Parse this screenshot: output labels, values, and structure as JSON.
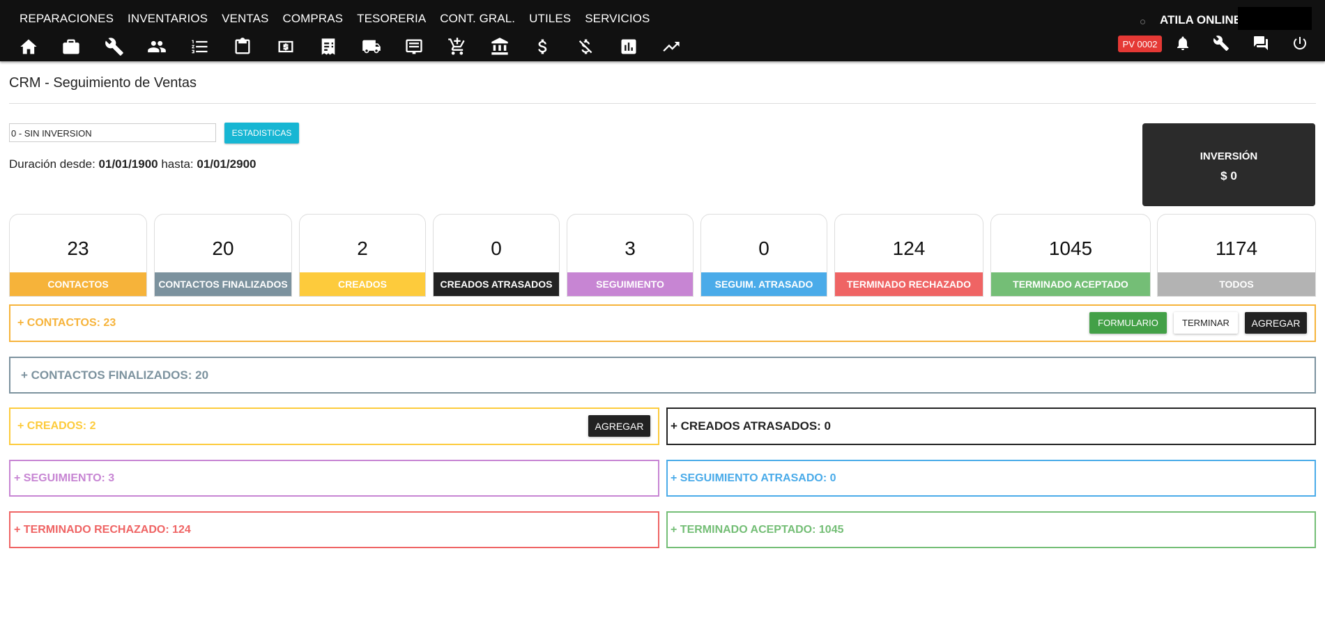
{
  "menu": [
    "REPARACIONES",
    "INVENTARIOS",
    "VENTAS",
    "COMPRAS",
    "TESORERIA",
    "CONT. GRAL.",
    "UTILES",
    "SERVICIOS"
  ],
  "toolbar_icons": [
    "home-icon",
    "briefcase-icon",
    "wrench-icon",
    "people-icon",
    "list-icon",
    "clipboard-icon",
    "money-icon",
    "invoice-icon",
    "truck-icon",
    "receipt-icon",
    "cart-icon",
    "bank-icon",
    "dollar-icon",
    "dollar-off-icon",
    "bar-chart-icon",
    "trending-icon"
  ],
  "user": "ATILA ONLINE",
  "pv_badge": "PV 0002",
  "page_title": "CRM - Seguimiento de Ventas",
  "select_value": "0 - SIN INVERSION",
  "stats_button": "ESTADISTICAS",
  "duration": {
    "prefix": "Duración desde: ",
    "from": "01/01/1900",
    "middle": " hasta: ",
    "to": "01/01/2900"
  },
  "investment": {
    "label": "INVERSIÓN",
    "value": "$ 0"
  },
  "cards": [
    {
      "value": "23",
      "label": "CONTACTOS",
      "color": "#f6b33a"
    },
    {
      "value": "20",
      "label": "CONTACTOS FINALIZADOS",
      "color": "#7c929e"
    },
    {
      "value": "2",
      "label": "CREADOS",
      "color": "#fdcb3c"
    },
    {
      "value": "0",
      "label": "CREADOS ATRASADOS",
      "color": "#222222"
    },
    {
      "value": "3",
      "label": "SEGUIMIENTO",
      "color": "#c785d3"
    },
    {
      "value": "0",
      "label": "SEGUIM. ATRASADO",
      "color": "#4aabe9"
    },
    {
      "value": "124",
      "label": "TERMINADO RECHAZADO",
      "color": "#ef6464"
    },
    {
      "value": "1045",
      "label": "TERMINADO ACEPTADO",
      "color": "#74be76"
    },
    {
      "value": "1174",
      "label": "TODOS",
      "color": "#b3b3b3"
    }
  ],
  "panels": {
    "contactos": {
      "text": "+ CONTACTOS: 23",
      "color": "#f6b33a",
      "buttons": {
        "formulario": "FORMULARIO",
        "terminar": "TERMINAR",
        "agregar": "AGREGAR"
      }
    },
    "finalizados": {
      "text": "+ CONTACTOS FINALIZADOS: 20",
      "color": "#7c929e"
    },
    "creados": {
      "text": "+ CREADOS: 2",
      "color": "#fdcb3c",
      "button": "AGREGAR"
    },
    "creados_atrasados": {
      "text": "+ CREADOS ATRASADOS: 0",
      "color": "#222222"
    },
    "seguimiento": {
      "text": "+ SEGUIMIENTO: 3",
      "color": "#c785d3"
    },
    "seguimiento_atrasado": {
      "text": "+ SEGUIMIENTO ATRASADO: 0",
      "color": "#4aabe9"
    },
    "rechazado": {
      "text": "+ TERMINADO RECHAZADO: 124",
      "color": "#ef6464"
    },
    "aceptado": {
      "text": "+ TERMINADO ACEPTADO: 1045",
      "color": "#74be76"
    }
  }
}
